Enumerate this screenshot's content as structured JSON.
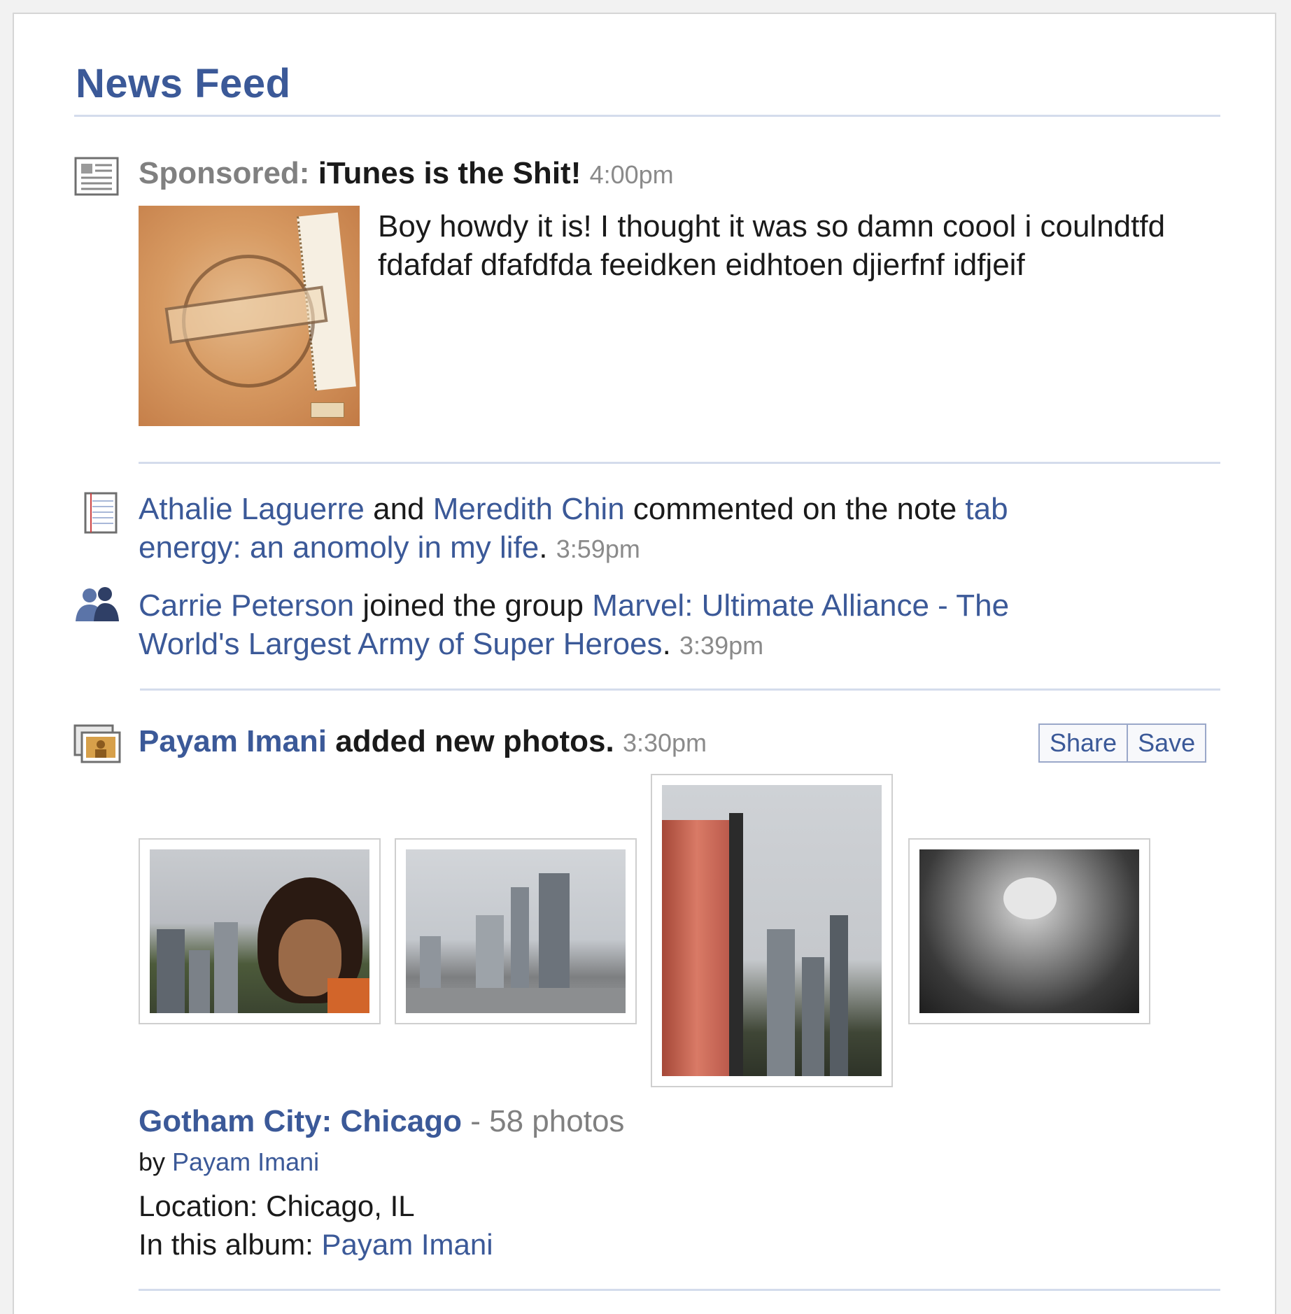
{
  "feed": {
    "title": "News Feed"
  },
  "sponsored": {
    "prefix": "Sponsored:",
    "headline": "iTunes is the Shit!",
    "time": "4:00pm",
    "body": "Boy howdy it is! I thought it was so damn coool i coulndtfd fdafdaf dfafdfda feeidken eidhtoen djierfnf idfjeif",
    "icon": "news-icon"
  },
  "note_story": {
    "icon": "note-icon",
    "actor1": "Athalie Laguerre",
    "and_text": " and ",
    "actor2": "Meredith Chin",
    "action": " commented on the note ",
    "note_title_part1": "tab",
    "note_title_part2": "energy: an anomoly in my life",
    "period": ".",
    "time": "3:59pm"
  },
  "group_story": {
    "icon": "group-icon",
    "actor": "Carrie Peterson",
    "action": " joined the group ",
    "group_part1": "Marvel: Ultimate Alliance - The",
    "group_part2": "World's Largest Army of Super Heroes",
    "period": ".",
    "time": "3:39pm"
  },
  "photo_story": {
    "icon": "photo-album-icon",
    "actor": "Payam Imani",
    "action": " added new photos.",
    "time": "3:30pm",
    "buttons": {
      "share": "Share",
      "save": "Save"
    },
    "album_title": "Gotham City: Chicago",
    "photo_count": "- 58 photos",
    "by_label": "by",
    "by_name": "Payam Imani",
    "location_label": "Location: ",
    "location": "Chicago, IL",
    "in_album_label": "In this album: ",
    "in_album_name": "Payam Imani"
  },
  "colors": {
    "link": "#3b5998",
    "time": "#8a8a8a",
    "rule": "#d4dcec"
  }
}
